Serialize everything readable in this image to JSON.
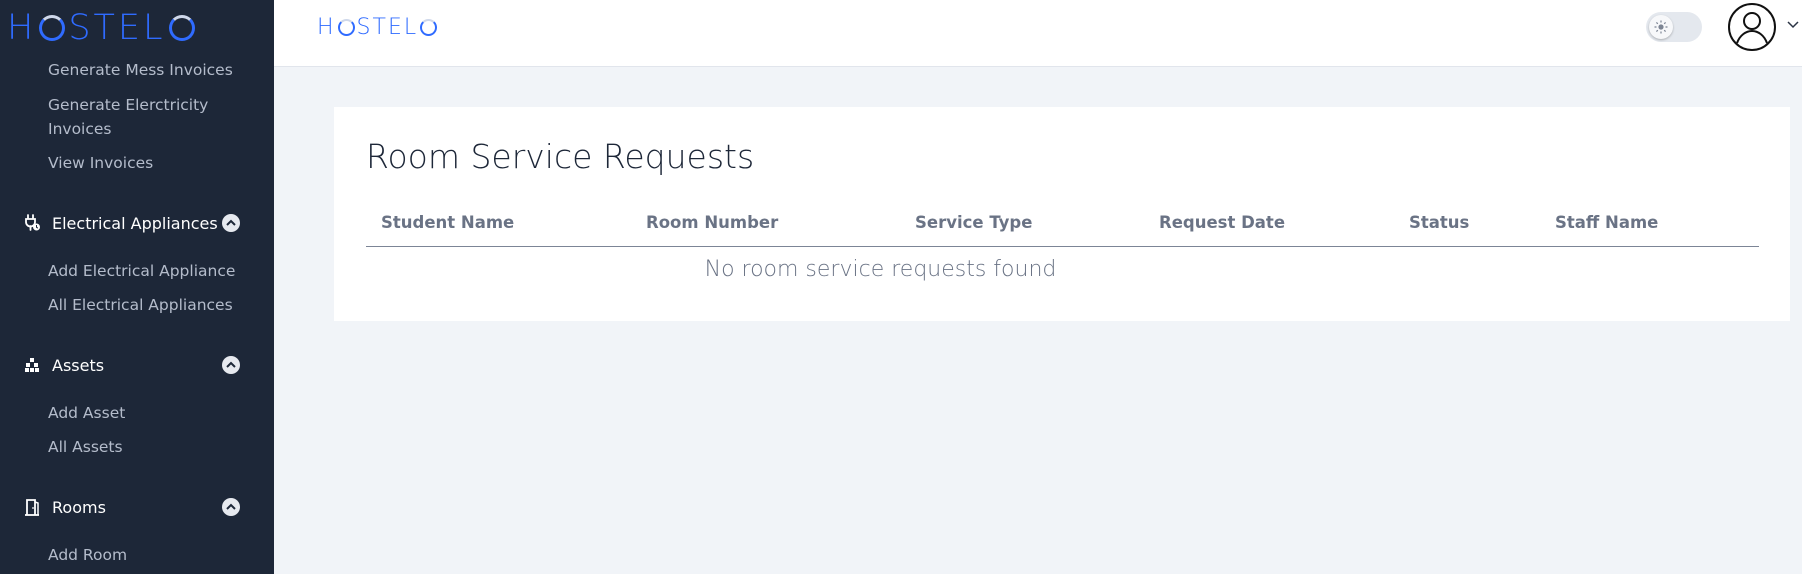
{
  "brand": {
    "sidebar_logo_left": "H",
    "sidebar_logo_right": "STEL",
    "topbar_logo_left": "H",
    "topbar_logo_right": "STEL",
    "logo_color": "#2f6bff"
  },
  "sidebar": {
    "background": "#1d2738",
    "invoice_links": [
      "Generate Mess Invoices",
      "Generate Elerctricity",
      "Invoices",
      "View Invoices"
    ],
    "sections": [
      {
        "label": "Electrical Appliances",
        "icon": "plug-icon",
        "expanded": true,
        "items": [
          "Add Electrical Appliance",
          "All Electrical Appliances"
        ]
      },
      {
        "label": "Assets",
        "icon": "boxes-icon",
        "expanded": true,
        "items": [
          "Add Asset",
          "All Assets"
        ]
      },
      {
        "label": "Rooms",
        "icon": "door-icon",
        "expanded": true,
        "items": [
          "Add Room"
        ]
      }
    ]
  },
  "topbar": {
    "theme_toggle": "sun-icon",
    "avatar": "user-circle-icon",
    "menu_caret": "chevron-down-icon"
  },
  "main": {
    "title": "Room Service Requests",
    "columns": [
      "Student Name",
      "Room Number",
      "Service Type",
      "Request Date",
      "Status",
      "Staff Name"
    ],
    "empty_message": "No room service requests found"
  }
}
